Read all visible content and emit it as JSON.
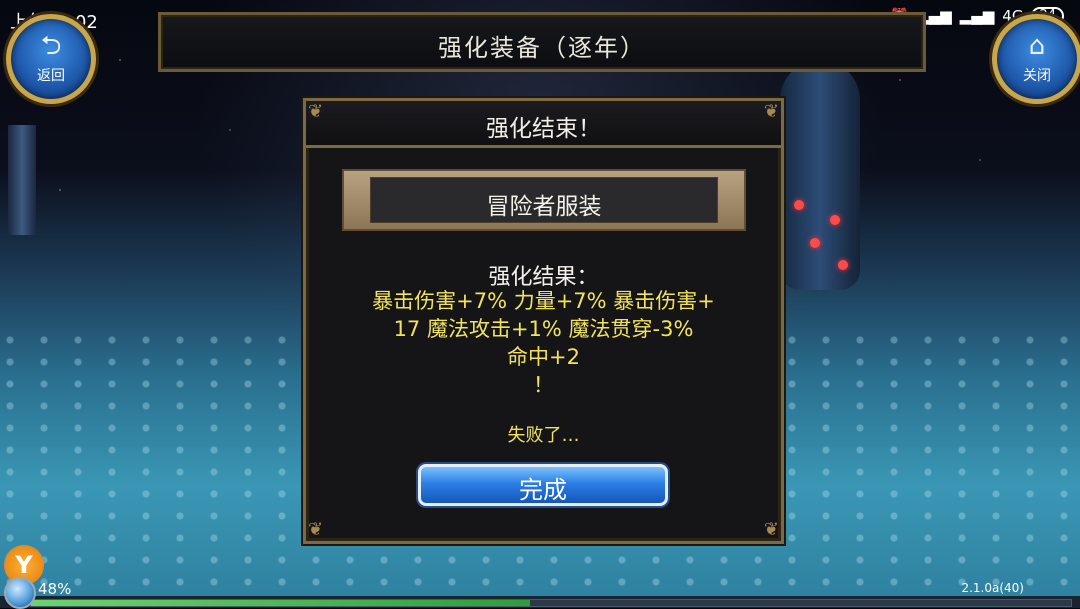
{
  "status_bar": {
    "time": "上午10:02",
    "icons": [
      "more-dots-icon",
      "alarm-icon",
      "signal-icon",
      "signal-icon",
      "network-4g-icon"
    ],
    "network": "4G",
    "battery": "24"
  },
  "header": {
    "title": "强化装备（逐年）",
    "back_label": "返回",
    "back_icon": "return-arrow-icon",
    "close_label": "关闭",
    "close_icon": "home-icon"
  },
  "dialog": {
    "title": "强化结束！",
    "item_name": "冒险者服装",
    "result_label": "强化结果：",
    "result_lines": [
      "暴击伤害+7% 力量+7% 暴击伤害+",
      "17 魔法攻击+1% 魔法贯穿-3%",
      "命中+2",
      "！"
    ],
    "status": "失败了…",
    "done_label": "完成"
  },
  "footer": {
    "progress_percent": "48%",
    "progress_fraction": 0.48,
    "version": "2.1.0a(40)",
    "badge": "Y"
  },
  "colors": {
    "accent_yellow": "#f3e35a",
    "button_blue": "#2c7fe6",
    "frame_gold": "#7c6a45"
  }
}
